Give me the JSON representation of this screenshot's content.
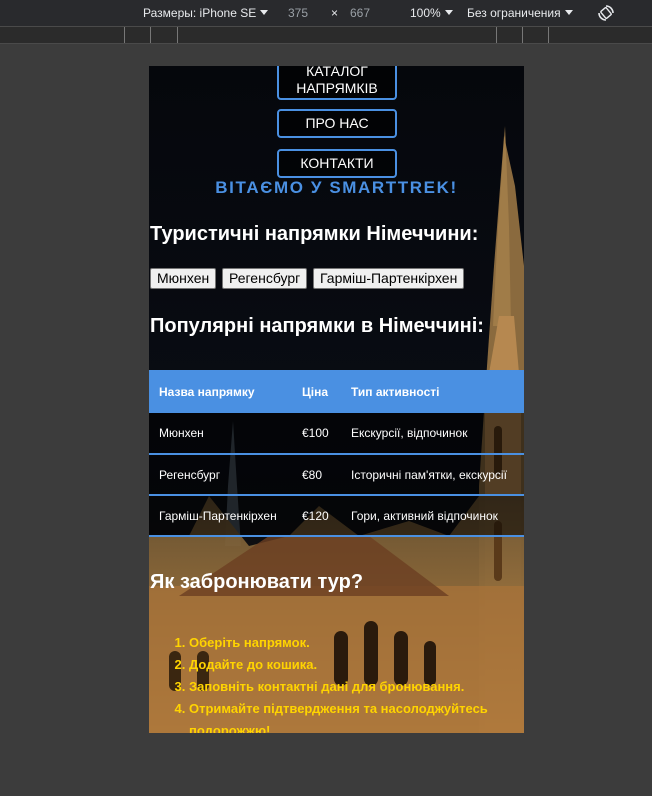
{
  "devtools": {
    "device_label": "Размеры: iPhone SE",
    "width": "375",
    "times": "×",
    "height": "667",
    "zoom": "100%",
    "throttle": "Без ограничения"
  },
  "page": {
    "nav": [
      "КАТАЛОГ НАПРЯМКІВ",
      "ПРО НАС",
      "КОНТАКТИ"
    ],
    "welcome": "ВІТАЄМО У SMARTTREK!",
    "tourist_heading": "Туристичні напрямки Німеччини:",
    "destinations": [
      "Мюнхен",
      "Регенсбург",
      "Гарміш-Партенкірхен"
    ],
    "popular_heading": "Популярні напрямки в Німеччині:",
    "table": {
      "headers": [
        "Назва напрямку",
        "Ціна",
        "Тип активності"
      ],
      "rows": [
        [
          "Мюнхен",
          "€100",
          "Екскурсії, відпочинок"
        ],
        [
          "Регенсбург",
          "€80",
          "Історичні пам'ятки, екскурсії"
        ],
        [
          "Гарміш-Партенкірхен",
          "€120",
          "Гори, активний відпочинок"
        ]
      ]
    },
    "booking_heading": "Як забронювати тур?",
    "steps": [
      "Оберіть напрямок.",
      "Додайте до кошика.",
      "Заповніть контактні дані для бронювання.",
      "Отримайте підтвердження та насолоджуйтесь подорожжю!"
    ]
  },
  "colors": {
    "accent": "#4a90e2",
    "steps": "#ffd400",
    "outer": "#3c3c3c"
  }
}
